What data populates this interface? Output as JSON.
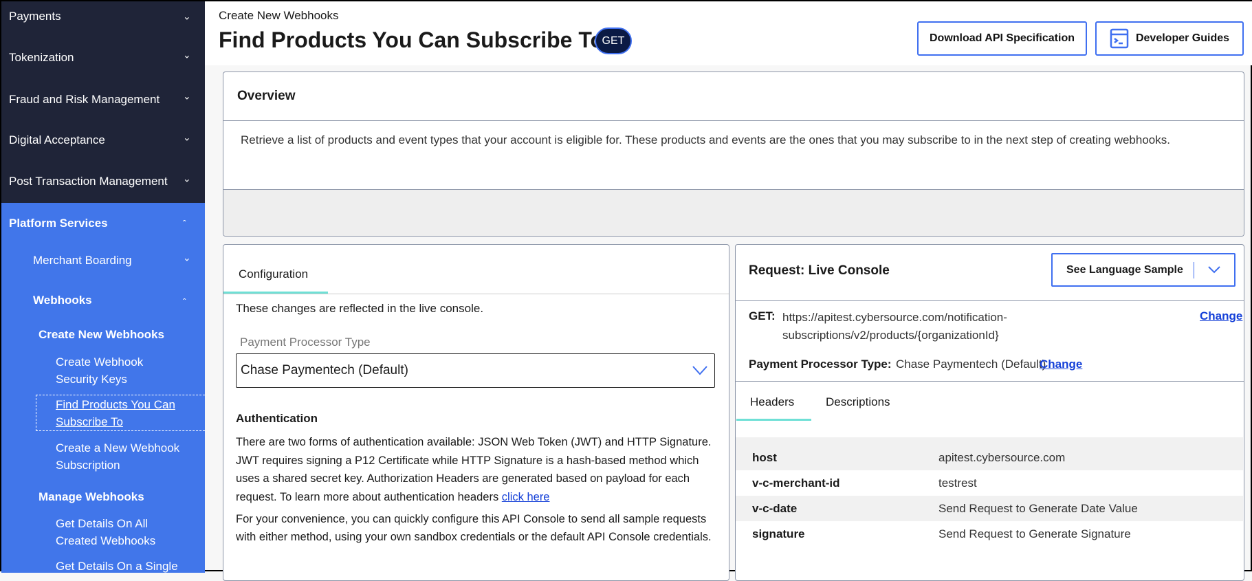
{
  "sidebar": {
    "items": [
      {
        "label": "Payments"
      },
      {
        "label": "Tokenization"
      },
      {
        "label": "Fraud and Risk Management"
      },
      {
        "label": "Digital Acceptance"
      },
      {
        "label": "Post Transaction Management"
      }
    ],
    "platform_services": "Platform Services",
    "merchant_boarding": "Merchant Boarding",
    "webhooks": "Webhooks",
    "create_new_webhooks": "Create New Webhooks",
    "create_keys": [
      "Create Webhook",
      "Security Keys"
    ],
    "find_products": [
      "Find Products You Can",
      "Subscribe To"
    ],
    "create_subscription": [
      "Create a New Webhook",
      "Subscription"
    ],
    "manage_webhooks": "Manage Webhooks",
    "get_all": [
      "Get Details On All",
      "Created Webhooks"
    ],
    "get_single": "Get Details On a Single"
  },
  "header": {
    "breadcrumb": "Create New Webhooks",
    "title": "Find Products You Can Subscribe To",
    "method": "GET",
    "download_label": "Download API Specification",
    "guides_label": "Developer Guides"
  },
  "overview": {
    "title": "Overview",
    "text": "Retrieve a list of products and event types that your account is eligible for. These products and events are the ones that you may subscribe to in the next step of creating webhooks."
  },
  "config": {
    "tab": "Configuration",
    "note": "These changes are reflected in the live console.",
    "ppt_label": "Payment Processor Type",
    "ppt_value": "Chase Paymentech (Default)",
    "auth_title": "Authentication",
    "auth_text": "There are two forms of authentication available: JSON Web Token (JWT) and HTTP Signature. JWT requires signing a P12 Certificate while HTTP Signature is a hash-based method which uses a shared secret key. Authorization Headers are generated based on payload for each request. To learn more about authentication headers ",
    "auth_link": "click here",
    "conv_text": "For your convenience, you can quickly configure this API Console to send all sample requests with either method, using your own sandbox credentials or the default API Console credentials."
  },
  "request": {
    "title": "Request: Live Console",
    "lang_button": "See Language Sample",
    "method_label": "GET:",
    "url": [
      "https://apitest.cybersource.com/notification-",
      "subscriptions/v2/products/{organizationId}"
    ],
    "change": "Change",
    "ppt_label": "Payment Processor Type:",
    "ppt_value": "Chase Paymentech (Default)",
    "tabs": [
      "Headers",
      "Descriptions"
    ],
    "headers": [
      {
        "k": "host",
        "v": "apitest.cybersource.com"
      },
      {
        "k": "v-c-merchant-id",
        "v": "testrest"
      },
      {
        "k": "v-c-date",
        "v": "Send Request to Generate Date Value"
      },
      {
        "k": "signature",
        "v": "Send Request to Generate Signature"
      }
    ]
  }
}
